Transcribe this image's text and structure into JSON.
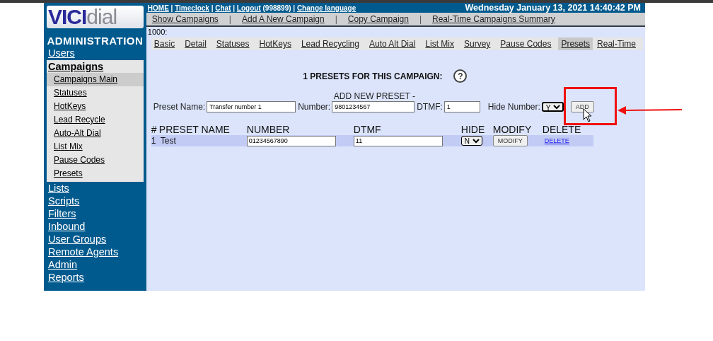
{
  "sidebar": {
    "logo_main": "VICI",
    "logo_tail": "dial",
    "title": "ADMINISTRATION",
    "items": [
      {
        "label": "Users",
        "expanded": false
      },
      {
        "label": "Campaigns",
        "expanded": true,
        "children": [
          {
            "label": "Campaigns Main",
            "selected": true
          },
          {
            "label": "Statuses",
            "selected": false
          },
          {
            "label": "HotKeys",
            "selected": false
          },
          {
            "label": "Lead Recycle",
            "selected": false
          },
          {
            "label": "Auto-Alt Dial",
            "selected": false
          },
          {
            "label": "List Mix",
            "selected": false
          },
          {
            "label": "Pause Codes",
            "selected": false
          },
          {
            "label": "Presets",
            "selected": false
          }
        ]
      },
      {
        "label": "Lists",
        "expanded": false
      },
      {
        "label": "Scripts",
        "expanded": false
      },
      {
        "label": "Filters",
        "expanded": false
      },
      {
        "label": "Inbound",
        "expanded": false
      },
      {
        "label": "User Groups",
        "expanded": false
      },
      {
        "label": "Remote Agents",
        "expanded": false
      },
      {
        "label": "Admin",
        "expanded": false
      },
      {
        "label": "Reports",
        "expanded": false
      }
    ]
  },
  "header": {
    "separator": "|",
    "links": [
      {
        "label": "HOME"
      },
      {
        "label": "Timeclock"
      },
      {
        "label": "Chat"
      },
      {
        "label": "Logout",
        "suffix": "(998899)"
      },
      {
        "label": "Change language"
      }
    ],
    "datetime": "Wednesday January 13, 2021 14:40:42 PM"
  },
  "nav": {
    "separator": "|",
    "items": [
      "Show Campaigns",
      "Add A New Campaign",
      "Copy Campaign",
      "Real-Time Campaigns Summary"
    ]
  },
  "campaign_id": "1000:",
  "subtabs": [
    {
      "label": "Basic",
      "selected": false
    },
    {
      "label": "Detail",
      "selected": false
    },
    {
      "label": "Statuses",
      "selected": false
    },
    {
      "label": "HotKeys",
      "selected": false
    },
    {
      "label": "Lead Recycling",
      "selected": false
    },
    {
      "label": "Auto Alt Dial",
      "selected": false
    },
    {
      "label": "List Mix",
      "selected": false
    },
    {
      "label": "Survey",
      "selected": false
    },
    {
      "label": "Pause Codes",
      "selected": false
    },
    {
      "label": "Presets",
      "selected": true
    },
    {
      "label": "Real-Time",
      "selected": false
    }
  ],
  "heading": "1 PRESETS FOR THIS CAMPAIGN:",
  "help": "?",
  "form": {
    "title": "ADD NEW PRESET -",
    "preset_name": {
      "label": "Preset Name:",
      "value": "Transfer number 1"
    },
    "number": {
      "label": "Number:",
      "value": "9801234567"
    },
    "dtmf": {
      "label": "DTMF:",
      "value": "1"
    },
    "hide_number": {
      "label": "Hide Number:",
      "value": "Y"
    },
    "button": "ADD"
  },
  "table": {
    "columns": [
      "#",
      "PRESET NAME",
      "NUMBER",
      "DTMF",
      "HIDE",
      "MODIFY",
      "DELETE"
    ],
    "rows": [
      {
        "index": "1",
        "name": "Test",
        "number": "01234567890",
        "dtmf": "11",
        "hide": "N",
        "modify": "MODIFY",
        "delete": "DELETE"
      }
    ]
  }
}
